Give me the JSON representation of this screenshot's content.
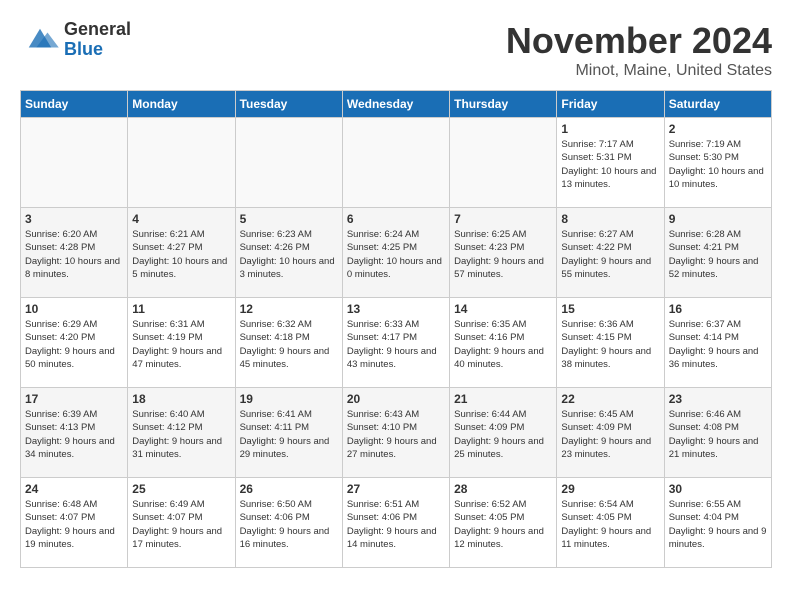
{
  "header": {
    "logo_line1": "General",
    "logo_line2": "Blue",
    "month_title": "November 2024",
    "location": "Minot, Maine, United States"
  },
  "days_of_week": [
    "Sunday",
    "Monday",
    "Tuesday",
    "Wednesday",
    "Thursday",
    "Friday",
    "Saturday"
  ],
  "weeks": [
    [
      {
        "day": "",
        "info": ""
      },
      {
        "day": "",
        "info": ""
      },
      {
        "day": "",
        "info": ""
      },
      {
        "day": "",
        "info": ""
      },
      {
        "day": "",
        "info": ""
      },
      {
        "day": "1",
        "info": "Sunrise: 7:17 AM\nSunset: 5:31 PM\nDaylight: 10 hours and 13 minutes."
      },
      {
        "day": "2",
        "info": "Sunrise: 7:19 AM\nSunset: 5:30 PM\nDaylight: 10 hours and 10 minutes."
      }
    ],
    [
      {
        "day": "3",
        "info": "Sunrise: 6:20 AM\nSunset: 4:28 PM\nDaylight: 10 hours and 8 minutes."
      },
      {
        "day": "4",
        "info": "Sunrise: 6:21 AM\nSunset: 4:27 PM\nDaylight: 10 hours and 5 minutes."
      },
      {
        "day": "5",
        "info": "Sunrise: 6:23 AM\nSunset: 4:26 PM\nDaylight: 10 hours and 3 minutes."
      },
      {
        "day": "6",
        "info": "Sunrise: 6:24 AM\nSunset: 4:25 PM\nDaylight: 10 hours and 0 minutes."
      },
      {
        "day": "7",
        "info": "Sunrise: 6:25 AM\nSunset: 4:23 PM\nDaylight: 9 hours and 57 minutes."
      },
      {
        "day": "8",
        "info": "Sunrise: 6:27 AM\nSunset: 4:22 PM\nDaylight: 9 hours and 55 minutes."
      },
      {
        "day": "9",
        "info": "Sunrise: 6:28 AM\nSunset: 4:21 PM\nDaylight: 9 hours and 52 minutes."
      }
    ],
    [
      {
        "day": "10",
        "info": "Sunrise: 6:29 AM\nSunset: 4:20 PM\nDaylight: 9 hours and 50 minutes."
      },
      {
        "day": "11",
        "info": "Sunrise: 6:31 AM\nSunset: 4:19 PM\nDaylight: 9 hours and 47 minutes."
      },
      {
        "day": "12",
        "info": "Sunrise: 6:32 AM\nSunset: 4:18 PM\nDaylight: 9 hours and 45 minutes."
      },
      {
        "day": "13",
        "info": "Sunrise: 6:33 AM\nSunset: 4:17 PM\nDaylight: 9 hours and 43 minutes."
      },
      {
        "day": "14",
        "info": "Sunrise: 6:35 AM\nSunset: 4:16 PM\nDaylight: 9 hours and 40 minutes."
      },
      {
        "day": "15",
        "info": "Sunrise: 6:36 AM\nSunset: 4:15 PM\nDaylight: 9 hours and 38 minutes."
      },
      {
        "day": "16",
        "info": "Sunrise: 6:37 AM\nSunset: 4:14 PM\nDaylight: 9 hours and 36 minutes."
      }
    ],
    [
      {
        "day": "17",
        "info": "Sunrise: 6:39 AM\nSunset: 4:13 PM\nDaylight: 9 hours and 34 minutes."
      },
      {
        "day": "18",
        "info": "Sunrise: 6:40 AM\nSunset: 4:12 PM\nDaylight: 9 hours and 31 minutes."
      },
      {
        "day": "19",
        "info": "Sunrise: 6:41 AM\nSunset: 4:11 PM\nDaylight: 9 hours and 29 minutes."
      },
      {
        "day": "20",
        "info": "Sunrise: 6:43 AM\nSunset: 4:10 PM\nDaylight: 9 hours and 27 minutes."
      },
      {
        "day": "21",
        "info": "Sunrise: 6:44 AM\nSunset: 4:09 PM\nDaylight: 9 hours and 25 minutes."
      },
      {
        "day": "22",
        "info": "Sunrise: 6:45 AM\nSunset: 4:09 PM\nDaylight: 9 hours and 23 minutes."
      },
      {
        "day": "23",
        "info": "Sunrise: 6:46 AM\nSunset: 4:08 PM\nDaylight: 9 hours and 21 minutes."
      }
    ],
    [
      {
        "day": "24",
        "info": "Sunrise: 6:48 AM\nSunset: 4:07 PM\nDaylight: 9 hours and 19 minutes."
      },
      {
        "day": "25",
        "info": "Sunrise: 6:49 AM\nSunset: 4:07 PM\nDaylight: 9 hours and 17 minutes."
      },
      {
        "day": "26",
        "info": "Sunrise: 6:50 AM\nSunset: 4:06 PM\nDaylight: 9 hours and 16 minutes."
      },
      {
        "day": "27",
        "info": "Sunrise: 6:51 AM\nSunset: 4:06 PM\nDaylight: 9 hours and 14 minutes."
      },
      {
        "day": "28",
        "info": "Sunrise: 6:52 AM\nSunset: 4:05 PM\nDaylight: 9 hours and 12 minutes."
      },
      {
        "day": "29",
        "info": "Sunrise: 6:54 AM\nSunset: 4:05 PM\nDaylight: 9 hours and 11 minutes."
      },
      {
        "day": "30",
        "info": "Sunrise: 6:55 AM\nSunset: 4:04 PM\nDaylight: 9 hours and 9 minutes."
      }
    ]
  ]
}
